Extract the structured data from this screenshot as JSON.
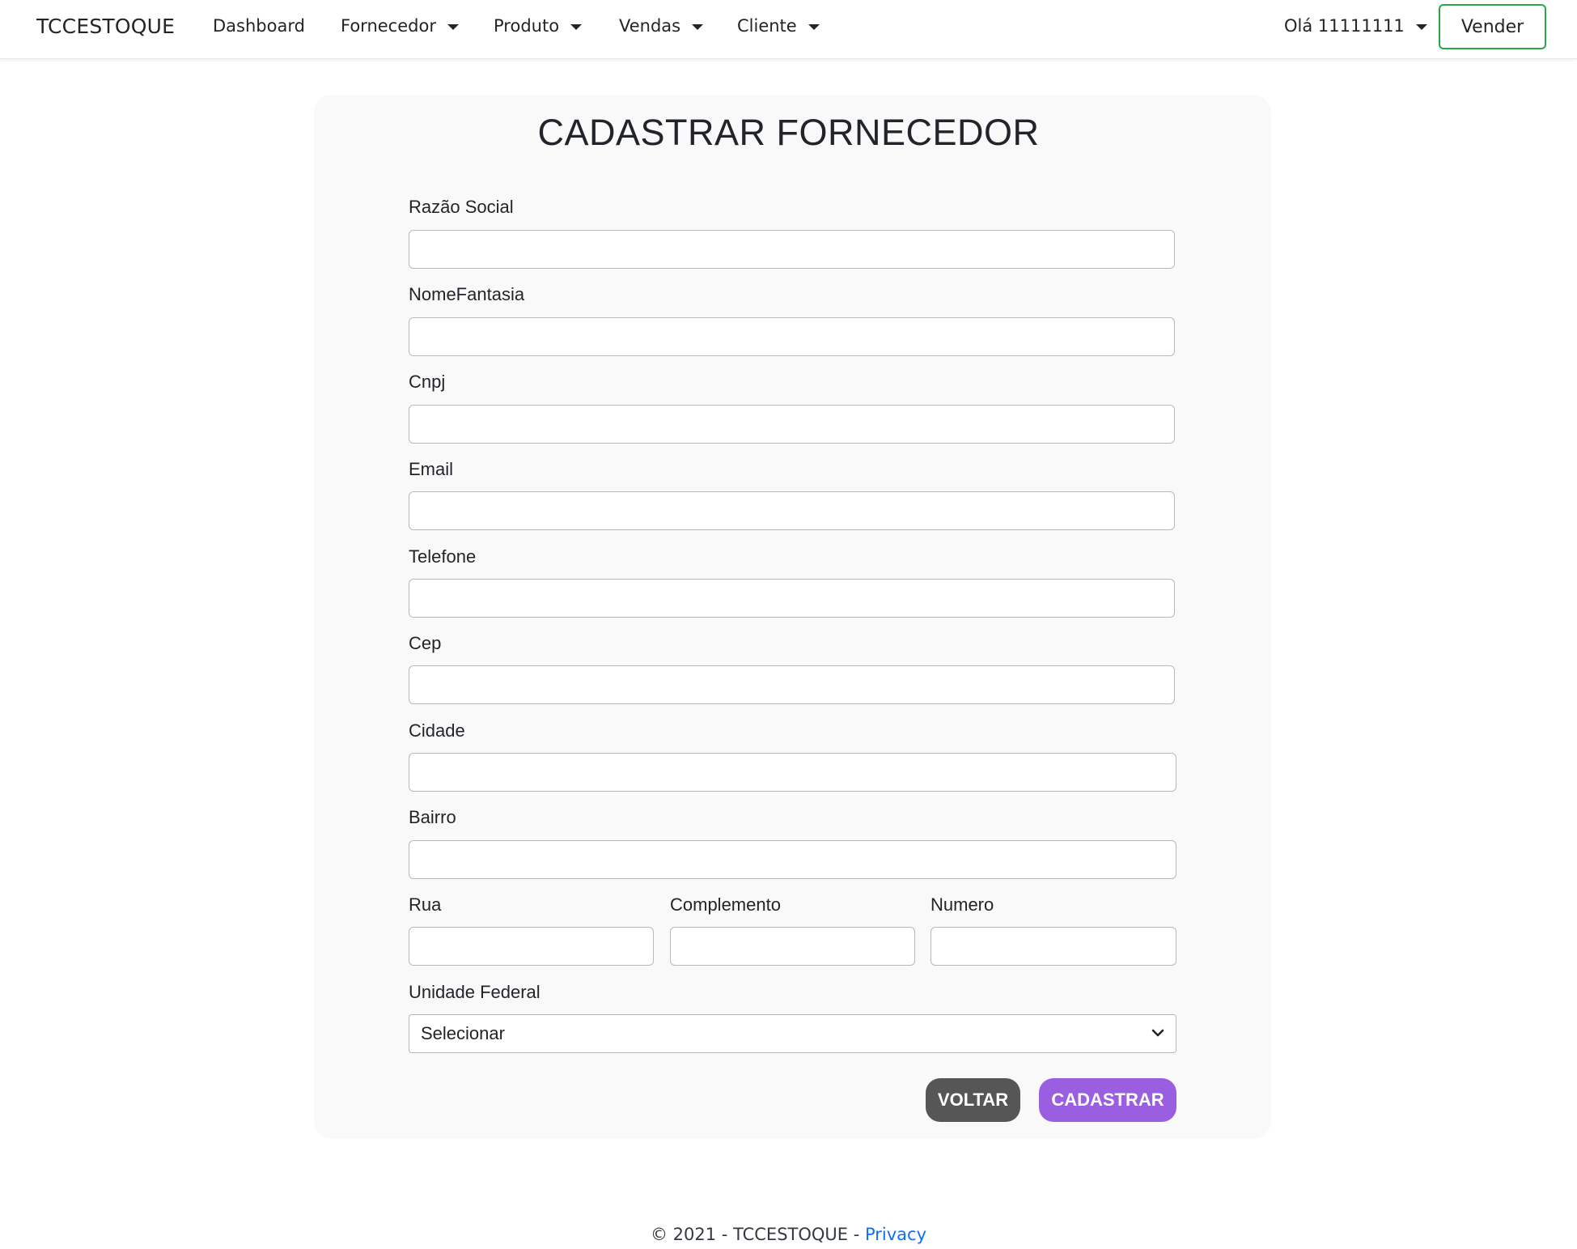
{
  "navbar": {
    "brand": "TCCESTOQUE",
    "items": [
      {
        "label": "Dashboard"
      },
      {
        "label": "Fornecedor"
      },
      {
        "label": "Produto"
      },
      {
        "label": "Vendas"
      },
      {
        "label": "Cliente"
      }
    ],
    "user_greeting": "Olá 11111111",
    "sell_button": "Vender"
  },
  "form": {
    "title": "CADASTRAR FORNECEDOR",
    "fields": {
      "razao_social": {
        "label": "Razão Social",
        "value": ""
      },
      "nome_fantasia": {
        "label": "NomeFantasia",
        "value": ""
      },
      "cnpj": {
        "label": "Cnpj",
        "value": ""
      },
      "email": {
        "label": "Email",
        "value": ""
      },
      "telefone": {
        "label": "Telefone",
        "value": ""
      },
      "cep": {
        "label": "Cep",
        "value": ""
      },
      "cidade": {
        "label": "Cidade",
        "value": ""
      },
      "bairro": {
        "label": "Bairro",
        "value": ""
      },
      "rua": {
        "label": "Rua",
        "value": ""
      },
      "complemento": {
        "label": "Complemento",
        "value": ""
      },
      "numero": {
        "label": "Numero",
        "value": ""
      }
    },
    "uf": {
      "label": "Unidade Federal",
      "selected": "Selecionar"
    },
    "back_button": "VOLTAR",
    "submit_button": "CADASTRAR"
  },
  "footer": {
    "text": "© 2021 - TCCESTOQUE - ",
    "link": "Privacy"
  },
  "colors": {
    "vender_border": "#28a745",
    "voltar_bg": "#565656",
    "cadastrar_bg": "#9a5ee0",
    "link": "#0d6efd"
  }
}
